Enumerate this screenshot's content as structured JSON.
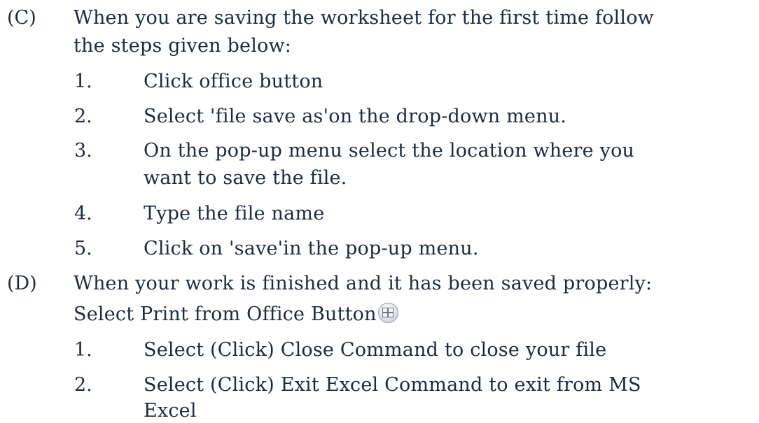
{
  "sections": [
    {
      "marker": "(C)",
      "lines": [
        "When you are saving the worksheet for the first time follow",
        "the steps given below:"
      ],
      "steps": [
        {
          "num": "1.",
          "lines": [
            "Click office button"
          ]
        },
        {
          "num": "2.",
          "lines": [
            "Select 'file save as'on the drop-down menu."
          ]
        },
        {
          "num": "3.",
          "lines": [
            "On the pop-up menu select the location where you",
            "want to save the file."
          ]
        },
        {
          "num": "4.",
          "lines": [
            "Type the file name"
          ]
        },
        {
          "num": "5.",
          "lines": [
            "Click on 'save'in the pop-up menu."
          ]
        }
      ]
    },
    {
      "marker": "(D)",
      "lines": [
        "When your work is finished and it has been saved properly:",
        "Select Print from Office Button"
      ],
      "steps": [
        {
          "num": "1.",
          "lines": [
            "Select (Click) Close Command to close your file"
          ]
        },
        {
          "num": "2.",
          "lines": [
            "Select (Click) Exit Excel Command to exit from MS",
            "Excel"
          ]
        }
      ]
    }
  ],
  "icons": {
    "office_button": "office-button-icon"
  }
}
